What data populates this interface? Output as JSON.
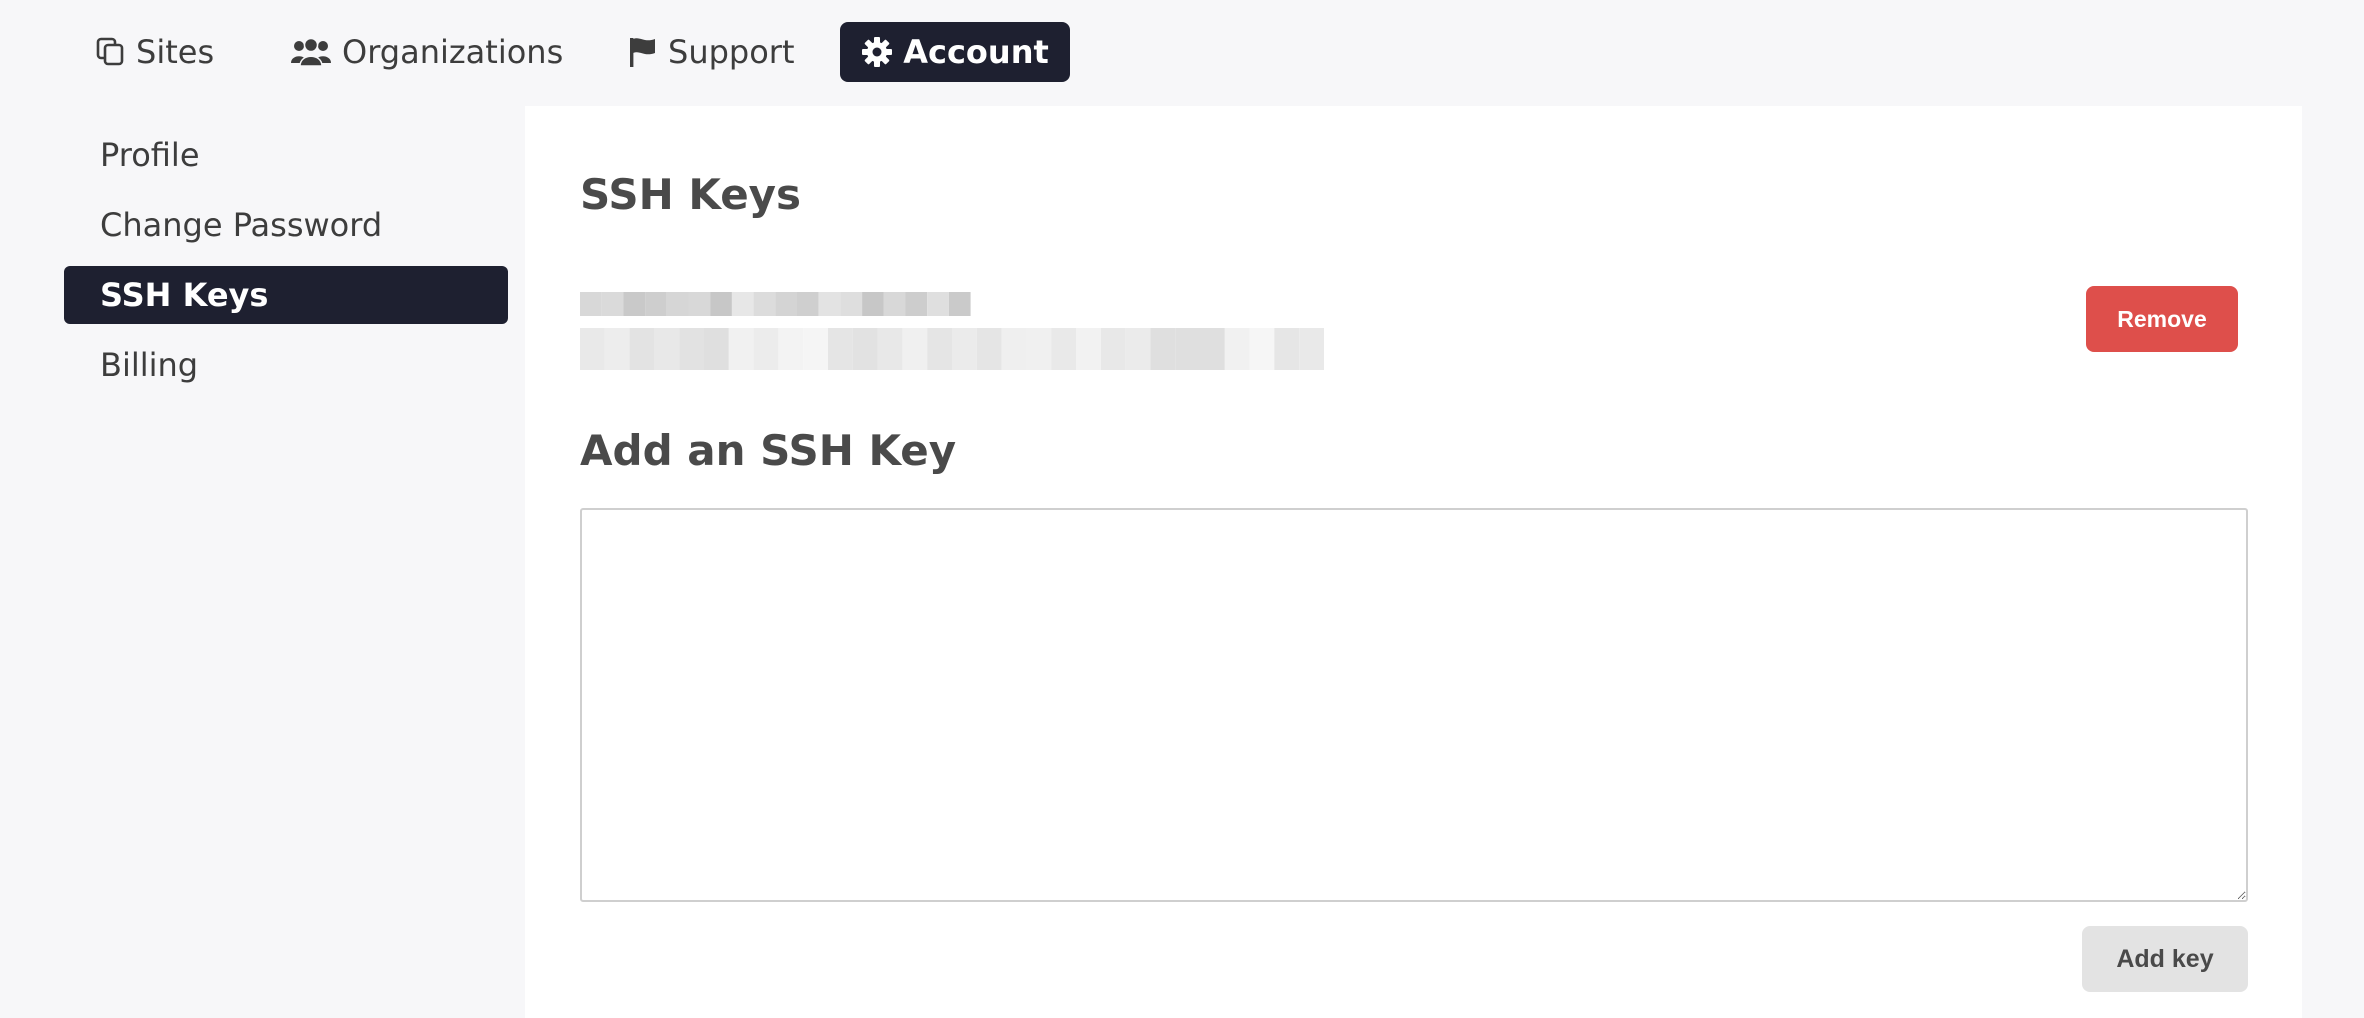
{
  "nav": {
    "items": [
      {
        "label": "Sites",
        "icon": "copy-icon"
      },
      {
        "label": "Organizations",
        "icon": "users-icon"
      },
      {
        "label": "Support",
        "icon": "flag-icon"
      },
      {
        "label": "Account",
        "icon": "gear-icon",
        "active": true
      }
    ]
  },
  "sidebar": {
    "items": [
      {
        "label": "Profile"
      },
      {
        "label": "Change Password"
      },
      {
        "label": "SSH Keys",
        "active": true
      },
      {
        "label": "Billing"
      }
    ]
  },
  "main": {
    "ssh_title": "SSH Keys",
    "existing_key": {
      "remove_label": "Remove"
    },
    "add_title": "Add an SSH Key",
    "textarea_value": "",
    "add_label": "Add key"
  },
  "colors": {
    "dark": "#1e2030",
    "danger": "#de4f4b",
    "neutral_button": "#e3e3e3",
    "background": "#f7f7f9"
  }
}
